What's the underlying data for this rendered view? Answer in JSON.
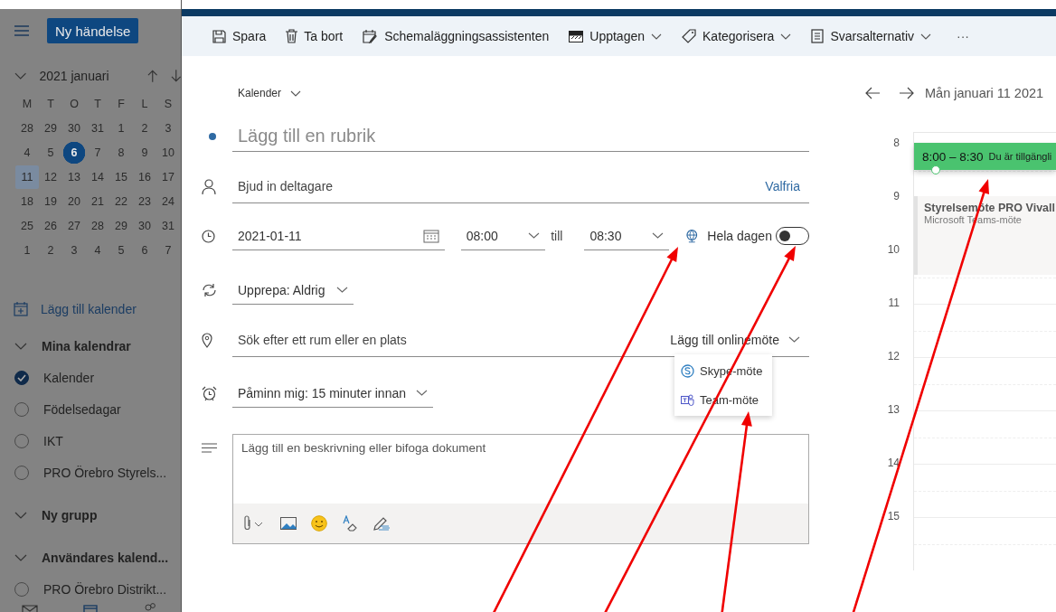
{
  "sidebar": {
    "new_event_button": "Ny händelse",
    "mini_calendar": {
      "title": "2021 januari",
      "weekdays": [
        "M",
        "T",
        "O",
        "T",
        "F",
        "L",
        "S"
      ],
      "weeks": [
        [
          {
            "day": "28",
            "selected": false,
            "today": false
          },
          {
            "day": "29",
            "selected": false,
            "today": false
          },
          {
            "day": "30",
            "selected": false,
            "today": false
          },
          {
            "day": "31",
            "selected": false,
            "today": false
          },
          {
            "day": "1",
            "selected": false,
            "today": false
          },
          {
            "day": "2",
            "selected": false,
            "today": false
          },
          {
            "day": "3",
            "selected": false,
            "today": false
          }
        ],
        [
          {
            "day": "4",
            "selected": false,
            "today": false
          },
          {
            "day": "5",
            "selected": false,
            "today": false
          },
          {
            "day": "6",
            "selected": false,
            "today": true
          },
          {
            "day": "7",
            "selected": false,
            "today": false
          },
          {
            "day": "8",
            "selected": false,
            "today": false
          },
          {
            "day": "9",
            "selected": false,
            "today": false
          },
          {
            "day": "10",
            "selected": false,
            "today": false
          }
        ],
        [
          {
            "day": "11",
            "selected": true,
            "today": false
          },
          {
            "day": "12",
            "selected": false,
            "today": false
          },
          {
            "day": "13",
            "selected": false,
            "today": false
          },
          {
            "day": "14",
            "selected": false,
            "today": false
          },
          {
            "day": "15",
            "selected": false,
            "today": false
          },
          {
            "day": "16",
            "selected": false,
            "today": false
          },
          {
            "day": "17",
            "selected": false,
            "today": false
          }
        ],
        [
          {
            "day": "18",
            "selected": false,
            "today": false
          },
          {
            "day": "19",
            "selected": false,
            "today": false
          },
          {
            "day": "20",
            "selected": false,
            "today": false
          },
          {
            "day": "21",
            "selected": false,
            "today": false
          },
          {
            "day": "22",
            "selected": false,
            "today": false
          },
          {
            "day": "23",
            "selected": false,
            "today": false
          },
          {
            "day": "24",
            "selected": false,
            "today": false
          }
        ],
        [
          {
            "day": "25",
            "selected": false,
            "today": false
          },
          {
            "day": "26",
            "selected": false,
            "today": false
          },
          {
            "day": "27",
            "selected": false,
            "today": false
          },
          {
            "day": "28",
            "selected": false,
            "today": false
          },
          {
            "day": "29",
            "selected": false,
            "today": false
          },
          {
            "day": "30",
            "selected": false,
            "today": false
          },
          {
            "day": "31",
            "selected": false,
            "today": false
          }
        ],
        [
          {
            "day": "1",
            "selected": false,
            "today": false
          },
          {
            "day": "2",
            "selected": false,
            "today": false
          },
          {
            "day": "3",
            "selected": false,
            "today": false
          },
          {
            "day": "4",
            "selected": false,
            "today": false
          },
          {
            "day": "5",
            "selected": false,
            "today": false
          },
          {
            "day": "6",
            "selected": false,
            "today": false
          },
          {
            "day": "7",
            "selected": false,
            "today": false
          }
        ]
      ]
    },
    "add_calendar": "Lägg till kalender",
    "groups": [
      {
        "title": "Mina kalendrar",
        "items": [
          {
            "name": "Kalender",
            "checked": true
          },
          {
            "name": "Födelsedagar",
            "checked": false
          },
          {
            "name": "IKT",
            "checked": false
          },
          {
            "name": "PRO Örebro Styrels...",
            "checked": false
          }
        ]
      },
      {
        "title": "Ny grupp"
      },
      {
        "title": "Användares kalend...",
        "items": [
          {
            "name": "PRO Örebro Distrikt...",
            "checked": false
          }
        ]
      }
    ]
  },
  "toolbar": [
    {
      "label": "Spara",
      "kind": "save",
      "dropdown": false
    },
    {
      "label": "Ta bort",
      "kind": "delete",
      "dropdown": false
    },
    {
      "label": "Schemaläggningsassistenten",
      "kind": "schedule",
      "dropdown": false
    },
    {
      "label": "Upptagen",
      "kind": "busy",
      "dropdown": true
    },
    {
      "label": "Kategorisera",
      "kind": "tag",
      "dropdown": true
    },
    {
      "label": "Svarsalternativ",
      "kind": "response",
      "dropdown": true
    }
  ],
  "toolbar_more": "···",
  "form": {
    "calendar_select": "Kalender",
    "title_placeholder": "Lägg till en rubrik",
    "attendees_placeholder": "Bjud in deltagare",
    "optional_link": "Valfria",
    "date": "2021-01-11",
    "start_time": "08:00",
    "till": "till",
    "end_time": "08:30",
    "all_day_label": "Hela dagen",
    "all_day": false,
    "repeat": "Upprepa: Aldrig",
    "location_placeholder": "Sök efter ett rum eller en plats",
    "online_meeting": "Lägg till onlinemöte",
    "online_menu": [
      {
        "label": "Skype-möte",
        "kind": "skype"
      },
      {
        "label": "Team-möte",
        "kind": "teams"
      }
    ],
    "reminder": "Påminn mig: 15 minuter innan",
    "description_placeholder": "Lägg till en beskrivning eller bifoga dokument"
  },
  "day_view": {
    "title": "Mån januari 11 2021",
    "hours": [
      "8",
      "9",
      "10",
      "11",
      "12",
      "13",
      "14",
      "15"
    ],
    "events": [
      {
        "kind": "new",
        "time": "8:00 – 8:30",
        "text": "Du är tillgängli"
      },
      {
        "kind": "busy",
        "title": "Styrelsemöte PRO Vivall",
        "subtitle": "Microsoft Teams-möte"
      }
    ]
  }
}
